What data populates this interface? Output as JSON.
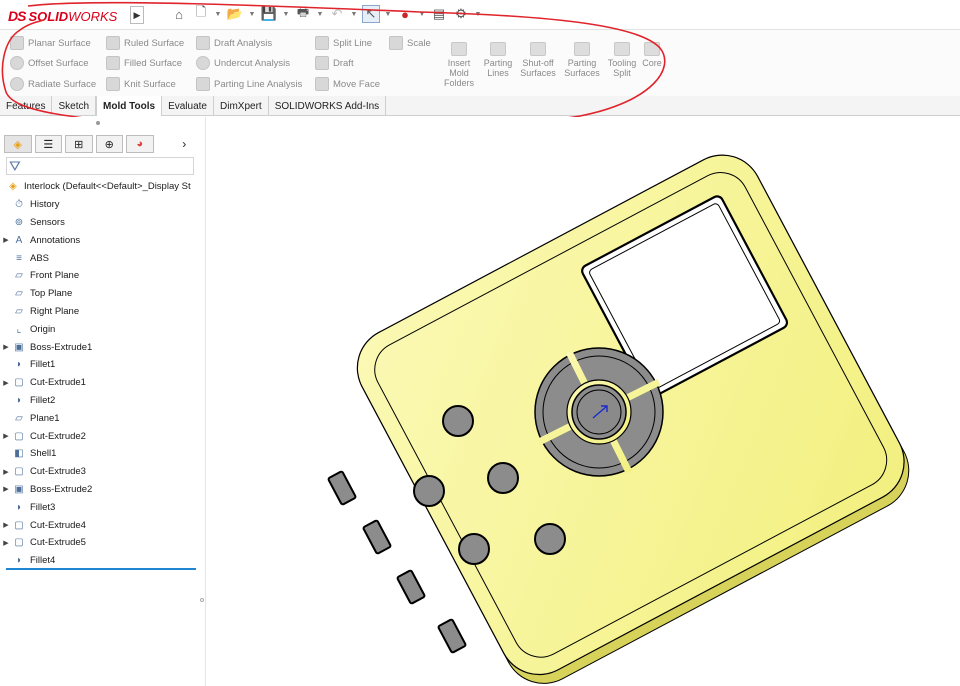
{
  "app": {
    "ds_mark": "DS",
    "brand_bold": "SOLID",
    "brand_light": "WORKS"
  },
  "toolbar": {
    "icons": [
      "home-icon",
      "new-document-icon",
      "open-folder-icon",
      "save-icon",
      "print-icon",
      "undo-icon",
      "select-pointer-icon",
      "traffic-light-icon",
      "file-properties-icon",
      "options-gear-icon"
    ]
  },
  "command_manager": {
    "col1": [
      "Planar Surface",
      "Offset Surface",
      "Radiate Surface"
    ],
    "col2": [
      "Ruled Surface",
      "Filled Surface",
      "Knit Surface"
    ],
    "col3": [
      "Draft Analysis",
      "Undercut Analysis",
      "Parting Line Analysis"
    ],
    "col4": [
      "Split Line",
      "Draft",
      "Move Face"
    ],
    "col5": [
      "Scale"
    ],
    "big_buttons": [
      {
        "label": "Insert Mold Folders"
      },
      {
        "label": "Parting Lines"
      },
      {
        "label": "Shut-off Surfaces"
      },
      {
        "label": "Parting Surfaces"
      },
      {
        "label": "Tooling Split"
      },
      {
        "label": "Core"
      }
    ]
  },
  "tabs": [
    "Features",
    "Sketch",
    "Mold Tools",
    "Evaluate",
    "DimXpert",
    "SOLIDWORKS Add-Ins"
  ],
  "active_tab": "Mold Tools",
  "panel": {
    "tabs": [
      "feature-manager-icon",
      "property-manager-icon",
      "configuration-manager-icon",
      "dimxpert-manager-icon",
      "display-manager-icon"
    ],
    "more": "›",
    "filter_icon": "filter-icon",
    "tree": [
      {
        "label": "Interlock  (Default<<Default>_Display St",
        "icon": "part-icon",
        "exp": false
      },
      {
        "label": "History",
        "icon": "history-icon",
        "exp": false
      },
      {
        "label": "Sensors",
        "icon": "sensors-icon",
        "exp": false
      },
      {
        "label": "Annotations",
        "icon": "annotations-icon",
        "exp": true
      },
      {
        "label": "ABS",
        "icon": "material-icon",
        "exp": false
      },
      {
        "label": "Front Plane",
        "icon": "plane-icon",
        "exp": false
      },
      {
        "label": "Top Plane",
        "icon": "plane-icon",
        "exp": false
      },
      {
        "label": "Right Plane",
        "icon": "plane-icon",
        "exp": false
      },
      {
        "label": "Origin",
        "icon": "origin-icon",
        "exp": false
      },
      {
        "label": "Boss-Extrude1",
        "icon": "boss-extrude-icon",
        "exp": true
      },
      {
        "label": "Fillet1",
        "icon": "fillet-icon",
        "exp": false
      },
      {
        "label": "Cut-Extrude1",
        "icon": "cut-extrude-icon",
        "exp": true
      },
      {
        "label": "Fillet2",
        "icon": "fillet-icon",
        "exp": false
      },
      {
        "label": "Plane1",
        "icon": "plane-icon",
        "exp": false
      },
      {
        "label": "Cut-Extrude2",
        "icon": "cut-extrude-icon",
        "exp": true
      },
      {
        "label": "Shell1",
        "icon": "shell-icon",
        "exp": false
      },
      {
        "label": "Cut-Extrude3",
        "icon": "cut-extrude-icon",
        "exp": true
      },
      {
        "label": "Boss-Extrude2",
        "icon": "boss-extrude-icon",
        "exp": true
      },
      {
        "label": "Fillet3",
        "icon": "fillet-icon",
        "exp": false
      },
      {
        "label": "Cut-Extrude4",
        "icon": "cut-extrude-icon",
        "exp": true
      },
      {
        "label": "Cut-Extrude5",
        "icon": "cut-extrude-icon",
        "exp": true
      },
      {
        "label": "Fillet4",
        "icon": "fillet-icon",
        "exp": false
      }
    ]
  },
  "colors": {
    "brand_red": "#d9001b",
    "annotation_red": "#e0242b",
    "part_yellow": "#f7f59a",
    "cavity_gray": "#8c8c8c"
  }
}
